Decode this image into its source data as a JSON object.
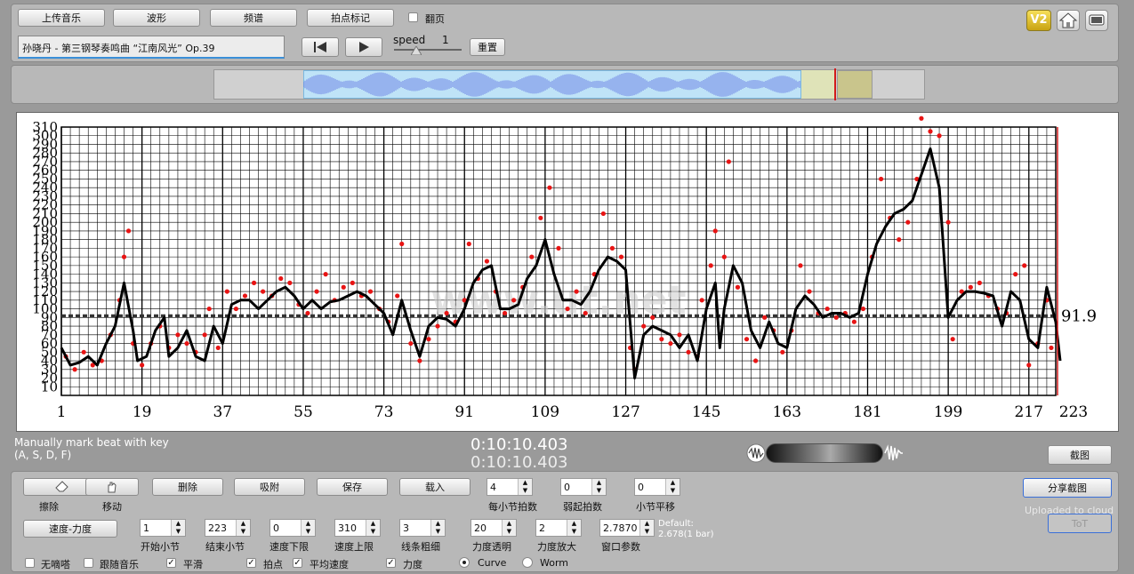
{
  "toolbar": {
    "upload": "上传音乐",
    "waveform": "波形",
    "spectrum": "频谱",
    "beat_mark": "拍点标记",
    "page_turn": "翻页"
  },
  "track": {
    "title": "孙晓丹 - 第三钢琴奏鸣曲 “江南风光” Op.39"
  },
  "playback": {
    "speed_label": "speed",
    "speed_value": "1",
    "reset": "重置"
  },
  "header_icons": {
    "v2": "V2"
  },
  "chart_data": {
    "type": "line",
    "xlim": [
      1,
      223
    ],
    "ylim": [
      0,
      310
    ],
    "x_ticks": [
      1,
      19,
      37,
      55,
      73,
      91,
      109,
      127,
      145,
      163,
      181,
      199,
      217,
      223
    ],
    "y_ticks": [
      10,
      20,
      30,
      40,
      50,
      60,
      70,
      80,
      90,
      100,
      110,
      120,
      130,
      140,
      150,
      160,
      170,
      180,
      190,
      200,
      210,
      220,
      230,
      240,
      250,
      260,
      270,
      280,
      290,
      300,
      310
    ],
    "average": 91.9,
    "average_label": "91.9",
    "watermark": "www.ut.net",
    "grid": true,
    "curve": [
      [
        1,
        55
      ],
      [
        3,
        35
      ],
      [
        5,
        38
      ],
      [
        7,
        45
      ],
      [
        9,
        35
      ],
      [
        11,
        60
      ],
      [
        13,
        80
      ],
      [
        15,
        130
      ],
      [
        17,
        75
      ],
      [
        18,
        40
      ],
      [
        20,
        45
      ],
      [
        22,
        75
      ],
      [
        24,
        90
      ],
      [
        25,
        45
      ],
      [
        27,
        55
      ],
      [
        29,
        75
      ],
      [
        31,
        45
      ],
      [
        33,
        40
      ],
      [
        35,
        80
      ],
      [
        37,
        60
      ],
      [
        39,
        105
      ],
      [
        41,
        110
      ],
      [
        43,
        110
      ],
      [
        45,
        100
      ],
      [
        47,
        110
      ],
      [
        49,
        120
      ],
      [
        51,
        125
      ],
      [
        53,
        115
      ],
      [
        55,
        100
      ],
      [
        57,
        110
      ],
      [
        59,
        100
      ],
      [
        61,
        108
      ],
      [
        63,
        110
      ],
      [
        65,
        115
      ],
      [
        67,
        120
      ],
      [
        69,
        115
      ],
      [
        71,
        105
      ],
      [
        73,
        95
      ],
      [
        75,
        70
      ],
      [
        77,
        110
      ],
      [
        79,
        75
      ],
      [
        81,
        45
      ],
      [
        83,
        80
      ],
      [
        85,
        90
      ],
      [
        87,
        88
      ],
      [
        89,
        80
      ],
      [
        91,
        100
      ],
      [
        93,
        130
      ],
      [
        95,
        145
      ],
      [
        97,
        150
      ],
      [
        99,
        100
      ],
      [
        101,
        100
      ],
      [
        103,
        105
      ],
      [
        105,
        135
      ],
      [
        107,
        150
      ],
      [
        109,
        180
      ],
      [
        111,
        140
      ],
      [
        113,
        110
      ],
      [
        115,
        110
      ],
      [
        117,
        105
      ],
      [
        119,
        120
      ],
      [
        121,
        145
      ],
      [
        123,
        160
      ],
      [
        125,
        155
      ],
      [
        127,
        145
      ],
      [
        129,
        20
      ],
      [
        131,
        70
      ],
      [
        133,
        80
      ],
      [
        135,
        75
      ],
      [
        137,
        70
      ],
      [
        139,
        55
      ],
      [
        141,
        70
      ],
      [
        143,
        40
      ],
      [
        145,
        100
      ],
      [
        147,
        130
      ],
      [
        148,
        55
      ],
      [
        149,
        100
      ],
      [
        151,
        150
      ],
      [
        153,
        130
      ],
      [
        155,
        75
      ],
      [
        157,
        55
      ],
      [
        159,
        85
      ],
      [
        161,
        60
      ],
      [
        163,
        55
      ],
      [
        165,
        100
      ],
      [
        167,
        115
      ],
      [
        169,
        105
      ],
      [
        171,
        90
      ],
      [
        173,
        95
      ],
      [
        175,
        95
      ],
      [
        177,
        90
      ],
      [
        179,
        95
      ],
      [
        181,
        140
      ],
      [
        183,
        175
      ],
      [
        185,
        195
      ],
      [
        187,
        210
      ],
      [
        189,
        215
      ],
      [
        191,
        225
      ],
      [
        193,
        255
      ],
      [
        195,
        285
      ],
      [
        197,
        240
      ],
      [
        199,
        90
      ],
      [
        201,
        110
      ],
      [
        203,
        120
      ],
      [
        205,
        120
      ],
      [
        207,
        118
      ],
      [
        209,
        115
      ],
      [
        211,
        80
      ],
      [
        213,
        120
      ],
      [
        215,
        110
      ],
      [
        217,
        65
      ],
      [
        219,
        55
      ],
      [
        221,
        125
      ],
      [
        223,
        85
      ],
      [
        224,
        40
      ]
    ],
    "points": [
      [
        2,
        45
      ],
      [
        4,
        30
      ],
      [
        6,
        50
      ],
      [
        8,
        35
      ],
      [
        10,
        40
      ],
      [
        12,
        70
      ],
      [
        14,
        110
      ],
      [
        15,
        160
      ],
      [
        16,
        190
      ],
      [
        17,
        60
      ],
      [
        19,
        35
      ],
      [
        21,
        60
      ],
      [
        23,
        80
      ],
      [
        25,
        55
      ],
      [
        27,
        70
      ],
      [
        29,
        60
      ],
      [
        31,
        50
      ],
      [
        33,
        70
      ],
      [
        34,
        100
      ],
      [
        36,
        55
      ],
      [
        38,
        120
      ],
      [
        40,
        100
      ],
      [
        42,
        115
      ],
      [
        44,
        130
      ],
      [
        46,
        120
      ],
      [
        48,
        115
      ],
      [
        50,
        135
      ],
      [
        52,
        130
      ],
      [
        54,
        105
      ],
      [
        56,
        95
      ],
      [
        58,
        120
      ],
      [
        60,
        140
      ],
      [
        62,
        110
      ],
      [
        64,
        125
      ],
      [
        66,
        130
      ],
      [
        68,
        115
      ],
      [
        70,
        120
      ],
      [
        72,
        100
      ],
      [
        74,
        85
      ],
      [
        76,
        115
      ],
      [
        77,
        175
      ],
      [
        79,
        60
      ],
      [
        81,
        40
      ],
      [
        83,
        65
      ],
      [
        85,
        80
      ],
      [
        87,
        95
      ],
      [
        89,
        85
      ],
      [
        91,
        110
      ],
      [
        92,
        175
      ],
      [
        94,
        135
      ],
      [
        96,
        155
      ],
      [
        98,
        120
      ],
      [
        100,
        95
      ],
      [
        102,
        110
      ],
      [
        104,
        125
      ],
      [
        106,
        160
      ],
      [
        108,
        205
      ],
      [
        110,
        240
      ],
      [
        112,
        170
      ],
      [
        114,
        100
      ],
      [
        116,
        120
      ],
      [
        118,
        95
      ],
      [
        120,
        140
      ],
      [
        122,
        210
      ],
      [
        124,
        170
      ],
      [
        126,
        160
      ],
      [
        128,
        55
      ],
      [
        129,
        30
      ],
      [
        131,
        80
      ],
      [
        133,
        90
      ],
      [
        135,
        65
      ],
      [
        137,
        60
      ],
      [
        139,
        70
      ],
      [
        141,
        50
      ],
      [
        143,
        45
      ],
      [
        144,
        110
      ],
      [
        146,
        150
      ],
      [
        147,
        190
      ],
      [
        149,
        160
      ],
      [
        150,
        270
      ],
      [
        152,
        125
      ],
      [
        154,
        65
      ],
      [
        156,
        40
      ],
      [
        158,
        90
      ],
      [
        160,
        75
      ],
      [
        162,
        50
      ],
      [
        164,
        75
      ],
      [
        166,
        150
      ],
      [
        168,
        120
      ],
      [
        170,
        95
      ],
      [
        172,
        100
      ],
      [
        174,
        90
      ],
      [
        176,
        95
      ],
      [
        178,
        85
      ],
      [
        180,
        100
      ],
      [
        182,
        160
      ],
      [
        184,
        250
      ],
      [
        186,
        205
      ],
      [
        188,
        180
      ],
      [
        190,
        200
      ],
      [
        192,
        250
      ],
      [
        193,
        320
      ],
      [
        195,
        305
      ],
      [
        197,
        300
      ],
      [
        199,
        200
      ],
      [
        200,
        65
      ],
      [
        202,
        120
      ],
      [
        204,
        125
      ],
      [
        206,
        130
      ],
      [
        208,
        115
      ],
      [
        210,
        100
      ],
      [
        212,
        95
      ],
      [
        214,
        140
      ],
      [
        216,
        150
      ],
      [
        217,
        35
      ],
      [
        219,
        60
      ],
      [
        221,
        110
      ],
      [
        222,
        55
      ]
    ]
  },
  "status": {
    "hint_line1": "Manually mark beat with key",
    "hint_line2": "(A, S, D, F)",
    "time_current": "0:10:10.403",
    "time_total": "0:10:10.403",
    "screenshot": "截图"
  },
  "controls": {
    "erase": "擦除",
    "move": "移动",
    "delete": "删除",
    "snap": "吸附",
    "save": "保存",
    "load": "载入",
    "beats_per_bar_label": "每小节拍数",
    "beats_per_bar": "4",
    "pickup_label": "弱起拍数",
    "pickup": "0",
    "bar_shift_label": "小节平移",
    "bar_shift": "0",
    "share": "分享截图",
    "uploaded": "Uploaded to cloud",
    "share_sub": "ToT",
    "tempo_dynamics": "速度-力度",
    "start_bar_label": "开始小节",
    "start_bar": "1",
    "end_bar_label": "结束小节",
    "end_bar": "223",
    "speed_min_label": "速度下限",
    "speed_min": "0",
    "speed_max_label": "速度上限",
    "speed_max": "310",
    "line_width_label": "线条粗细",
    "line_width": "3",
    "dyn_alpha_label": "力度透明",
    "dyn_alpha": "20",
    "dyn_scale_label": "力度放大",
    "dyn_scale": "2",
    "window_label": "窗口参数",
    "window": "2.7870",
    "default_line1": "Default:",
    "default_line2": "2.678(1 bar)",
    "no_click": "无嘀嗒",
    "follow_music": "跟随音乐",
    "smooth": "平滑",
    "beat_points": "拍点",
    "avg_speed": "平均速度",
    "dynamics": "力度",
    "curve": "Curve",
    "worm": "Worm"
  }
}
